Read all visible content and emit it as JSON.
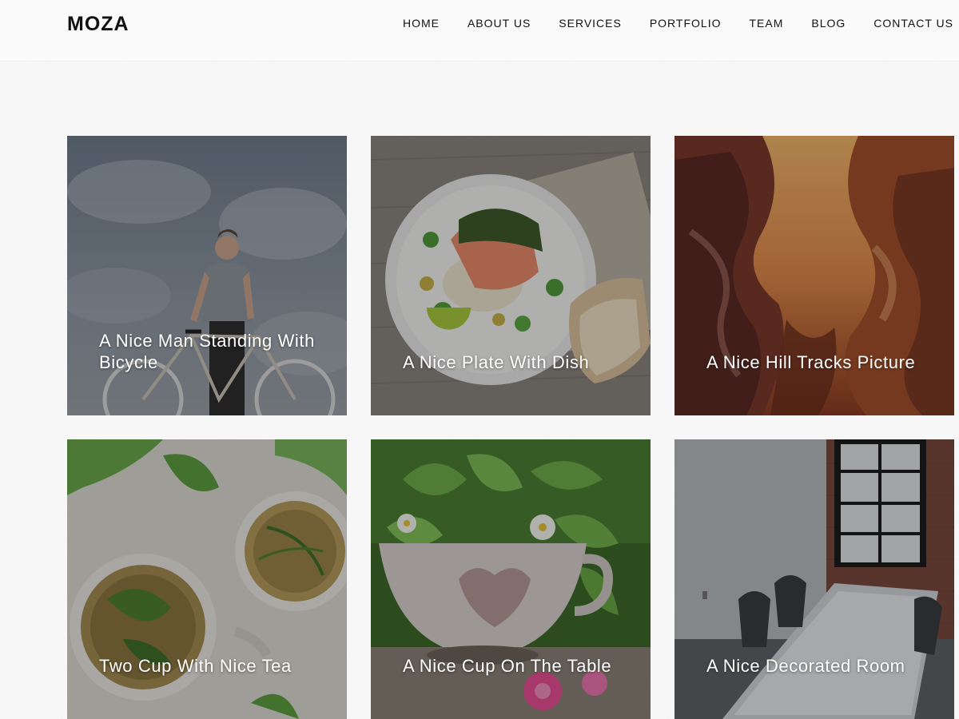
{
  "brand": {
    "logo": "MOZA"
  },
  "nav": {
    "items": [
      {
        "label": "HOME"
      },
      {
        "label": "ABOUT US"
      },
      {
        "label": "SERVICES"
      },
      {
        "label": "PORTFOLIO"
      },
      {
        "label": "TEAM"
      },
      {
        "label": "BLOG"
      },
      {
        "label": "CONTACT US"
      }
    ]
  },
  "gallery": {
    "items": [
      {
        "caption": "A Nice Man Standing With Bicycle",
        "image": "man-with-bicycle-photo"
      },
      {
        "caption": "A Nice Plate With Dish",
        "image": "plate-with-dish-photo"
      },
      {
        "caption": "A Nice Hill Tracks Picture",
        "image": "canyon-photo"
      },
      {
        "caption": "Two Cup With Nice Tea",
        "image": "tea-cups-photo"
      },
      {
        "caption": "A Nice Cup On The Table",
        "image": "cup-with-leaves-photo"
      },
      {
        "caption": "A Nice Decorated Room",
        "image": "meeting-room-photo"
      }
    ]
  },
  "colors": {
    "background": "#f8f8f8",
    "text": "#111111",
    "caption": "#ffffff"
  }
}
